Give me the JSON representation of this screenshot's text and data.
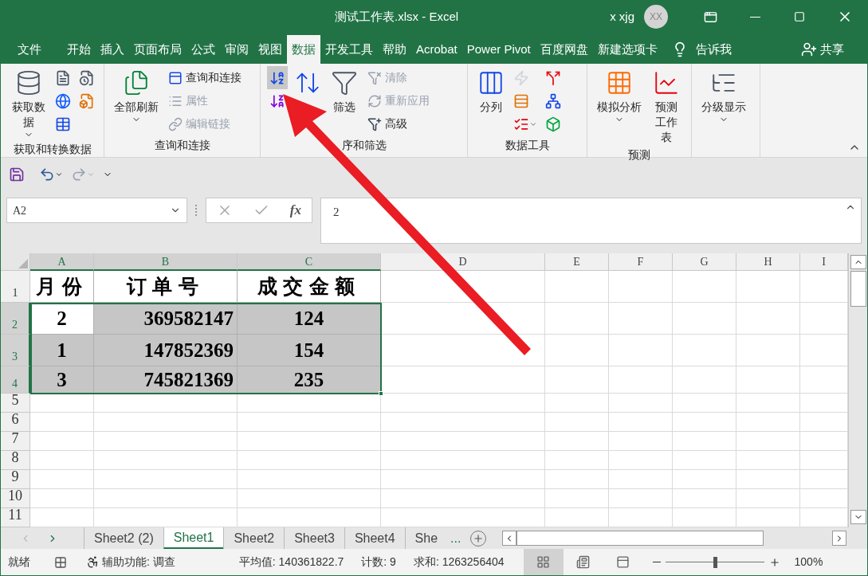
{
  "window": {
    "title": "测试工作表.xlsx  -  Excel",
    "user": "x xjg",
    "avatar": "XX"
  },
  "menu_tabs": [
    {
      "label": "文件",
      "selected": false
    },
    {
      "label": "开始",
      "selected": false
    },
    {
      "label": "插入",
      "selected": false
    },
    {
      "label": "页面布局",
      "selected": false
    },
    {
      "label": "公式",
      "selected": false
    },
    {
      "label": "审阅",
      "selected": false
    },
    {
      "label": "视图",
      "selected": false
    },
    {
      "label": "数据",
      "selected": true
    },
    {
      "label": "开发工具",
      "selected": false
    },
    {
      "label": "帮助",
      "selected": false
    },
    {
      "label": "Acrobat",
      "selected": false
    },
    {
      "label": "Power Pivot",
      "selected": false
    },
    {
      "label": "百度网盘",
      "selected": false
    },
    {
      "label": "新建选项卡",
      "selected": false
    }
  ],
  "tell_me": "告诉我",
  "share": "共享",
  "ribbon": {
    "groups": [
      {
        "label": "获取和转换数据",
        "items": [
          {
            "kind": "large",
            "label": "获取数据",
            "dropdown": true
          },
          {
            "kind": "icon"
          },
          {
            "kind": "icon"
          },
          {
            "kind": "icon"
          },
          {
            "kind": "icon"
          },
          {
            "kind": "icon"
          }
        ]
      },
      {
        "label": "查询和连接",
        "items": [
          {
            "kind": "large",
            "label": "全部刷新",
            "dropdown": true
          },
          {
            "kind": "small",
            "label": "查询和连接",
            "disabled": false
          },
          {
            "kind": "small",
            "label": "属性",
            "disabled": true
          },
          {
            "kind": "small",
            "label": "编辑链接",
            "disabled": true
          }
        ]
      },
      {
        "label": "序和筛选",
        "items": [
          {
            "kind": "icon",
            "hovered": true
          },
          {
            "kind": "icon",
            "hovered": false
          },
          {
            "kind": "large"
          },
          {
            "kind": "large",
            "label": "筛选"
          },
          {
            "kind": "small",
            "label": "清除",
            "disabled": true
          },
          {
            "kind": "small",
            "label": "重新应用",
            "disabled": true
          },
          {
            "kind": "small",
            "label": "高级",
            "disabled": false
          }
        ]
      },
      {
        "label": "数据工具",
        "items": [
          {
            "kind": "large",
            "label": "分列"
          },
          {
            "kind": "icon",
            "disabled": true
          },
          {
            "kind": "icon"
          },
          {
            "kind": "icon",
            "dropdown": true
          },
          {
            "kind": "icon"
          },
          {
            "kind": "icon"
          },
          {
            "kind": "icon"
          }
        ]
      },
      {
        "label": "预测",
        "items": [
          {
            "kind": "large",
            "label": "模拟分析",
            "dropdown": true
          },
          {
            "kind": "large",
            "label": "预测工作表"
          }
        ]
      },
      {
        "items": [
          {
            "kind": "large",
            "label": "分级显示",
            "dropdown": true
          }
        ]
      }
    ]
  },
  "formula_bar": {
    "name_box": "A2",
    "fx": "fx",
    "value": "2"
  },
  "columns": [
    {
      "label": "A",
      "selected": true
    },
    {
      "label": "B",
      "selected": true
    },
    {
      "label": "C",
      "selected": true
    },
    {
      "label": "D",
      "selected": false
    },
    {
      "label": "E",
      "selected": false
    },
    {
      "label": "F",
      "selected": false
    },
    {
      "label": "G",
      "selected": false
    },
    {
      "label": "H",
      "selected": false
    },
    {
      "label": "I",
      "selected": false
    }
  ],
  "rows": [
    {
      "header": "1",
      "selected": false,
      "cells": [
        {
          "text": "月份",
          "selected": false
        },
        {
          "text": "订单号",
          "selected": false
        },
        {
          "text": "成交金额",
          "selected": false
        }
      ]
    },
    {
      "header": "2",
      "selected": true,
      "cells": [
        {
          "text": "2",
          "selected": false
        },
        {
          "text": "369582147",
          "selected": true
        },
        {
          "text": "124",
          "selected": true
        }
      ]
    },
    {
      "header": "3",
      "selected": true,
      "cells": [
        {
          "text": "1",
          "selected": true
        },
        {
          "text": "147852369",
          "selected": true
        },
        {
          "text": "154",
          "selected": true
        }
      ]
    },
    {
      "header": "4",
      "selected": true,
      "cells": [
        {
          "text": "3",
          "selected": true
        },
        {
          "text": "745821369",
          "selected": true
        },
        {
          "text": "235",
          "selected": true
        }
      ]
    },
    {
      "header": "5",
      "selected": false,
      "cells": []
    },
    {
      "header": "6",
      "selected": false,
      "cells": []
    },
    {
      "header": "7",
      "selected": false,
      "cells": []
    },
    {
      "header": "8",
      "selected": false,
      "cells": []
    },
    {
      "header": "9",
      "selected": false,
      "cells": []
    },
    {
      "header": "10",
      "selected": false,
      "cells": []
    },
    {
      "header": "11",
      "selected": false,
      "cells": []
    }
  ],
  "sheets": [
    {
      "label": "Sheet2 (2)",
      "selected": false
    },
    {
      "label": "Sheet1",
      "selected": true
    },
    {
      "label": "Sheet2",
      "selected": false
    },
    {
      "label": "Sheet3",
      "selected": false
    },
    {
      "label": "Sheet4",
      "selected": false
    },
    {
      "label": "She",
      "selected": false
    }
  ],
  "more_sheets": "...",
  "status_bar": {
    "ready": "就绪",
    "accessibility": "辅助功能: 调查",
    "average": "平均值: 140361822.7",
    "count": "计数: 9",
    "sum": "求和: 1263256404",
    "views": [
      {
        "kind": "normal",
        "selected": true
      },
      {
        "kind": "page_layout",
        "selected": false
      },
      {
        "kind": "page_break",
        "selected": false
      }
    ],
    "zoom": {
      "level": 0.5,
      "reading": "100%"
    }
  }
}
